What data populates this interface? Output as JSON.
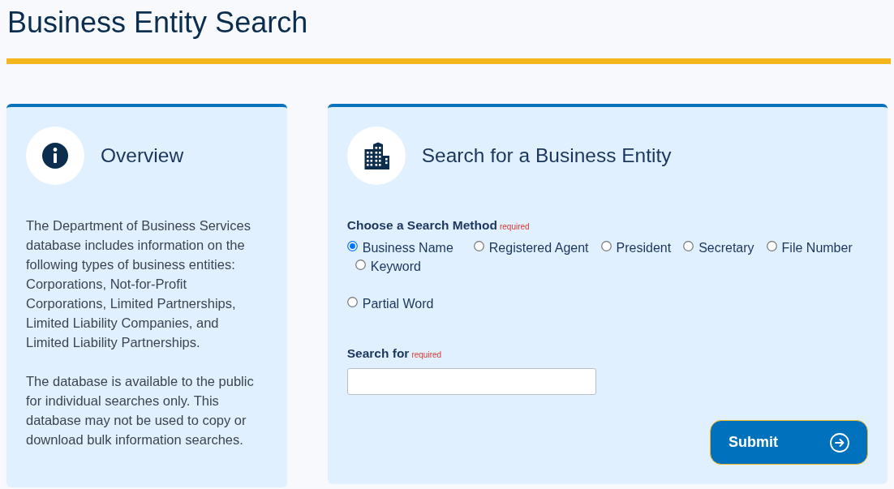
{
  "page": {
    "title": "Business Entity Search"
  },
  "overview": {
    "title": "Overview",
    "paragraphs": [
      "The Department of Business Services database includes information on the following types of business entities: Corporations, Not-for-Profit Corporations, Limited Partnerships, Limited Liability Companies, and Limited Liability Partnerships.",
      "The database is available to the public for individual searches only. This database may not be used to copy or download bulk information searches."
    ]
  },
  "search_panel": {
    "title": "Search for a Business Entity",
    "method": {
      "label": "Choose a Search Method",
      "required_note": "required",
      "options": [
        {
          "label": "Business Name",
          "selected": true
        },
        {
          "label": "Registered Agent",
          "selected": false
        },
        {
          "label": "President",
          "selected": false
        },
        {
          "label": "Secretary",
          "selected": false
        },
        {
          "label": "File Number",
          "selected": false
        },
        {
          "label": "Keyword",
          "selected": false
        }
      ],
      "more_options": [
        {
          "label": "Partial Word",
          "selected": false
        }
      ]
    },
    "search_for": {
      "label": "Search for",
      "required_note": "required"
    },
    "submit": {
      "label": "Submit"
    }
  }
}
